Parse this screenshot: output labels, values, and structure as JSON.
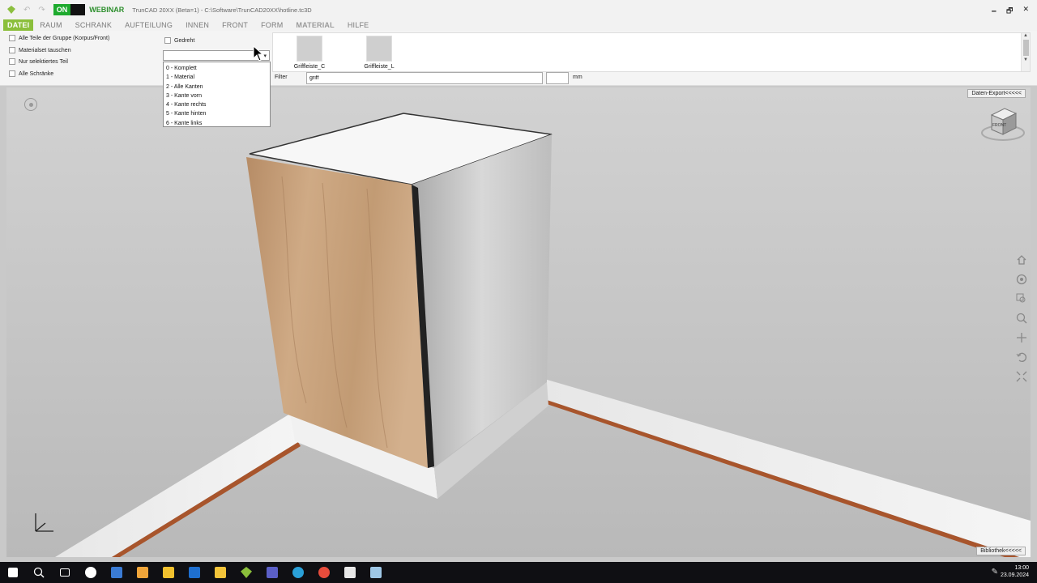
{
  "window": {
    "title": "TrunCAD 20XX (Beta=1) - C:\\Software\\TrunCAD20XX\\hotline.tc3D",
    "on_badge": "ON",
    "webinar": "WEBINAR",
    "undo_glyph": "↶",
    "redo_glyph": "↷",
    "minimize": "🗕",
    "restore": "🗗",
    "close": "✕"
  },
  "menu": [
    "DATEI",
    "RAUM",
    "SCHRANK",
    "AUFTEILUNG",
    "INNEN",
    "FRONT",
    "FORM",
    "MATERIAL",
    "HILFE"
  ],
  "ribbon": {
    "checkboxes": [
      "Alle Teile der Gruppe (Korpus/Front)",
      "Materialset tauschen",
      "Nur selektiertes Teil",
      "Alle Schränke"
    ],
    "gedreht": "Gedreht",
    "combo_arrow": "▾",
    "dropdown_options": [
      "0 - Komplett",
      "1 - Material",
      "2 - Alle Kanten",
      "3 - Kante vorn",
      "4 - Kante rechts",
      "5 - Kante hinten",
      "6 - Kante links"
    ],
    "library_items": [
      "Griffleiste_C",
      "Griffleiste_L"
    ],
    "scroll_up": "▲",
    "scroll_down": "▼",
    "filter_label": "Filter",
    "filter_value": "griff",
    "unit_label": "mm"
  },
  "viewport": {
    "daten_export": "Daten-Export<<<<<",
    "bibliothek": "Bibliothek<<<<<",
    "cube_label": "FRONT"
  },
  "taskbar": {
    "time": "13:00",
    "date": "23.09.2024",
    "pen_glyph": "✎"
  },
  "colors": {
    "accent": "#8bbf3b",
    "on_green": "#1eaa2e",
    "webinar_green": "#2d8f2d",
    "oak": "#c7a07a",
    "taskbar": "#0f0f13"
  }
}
